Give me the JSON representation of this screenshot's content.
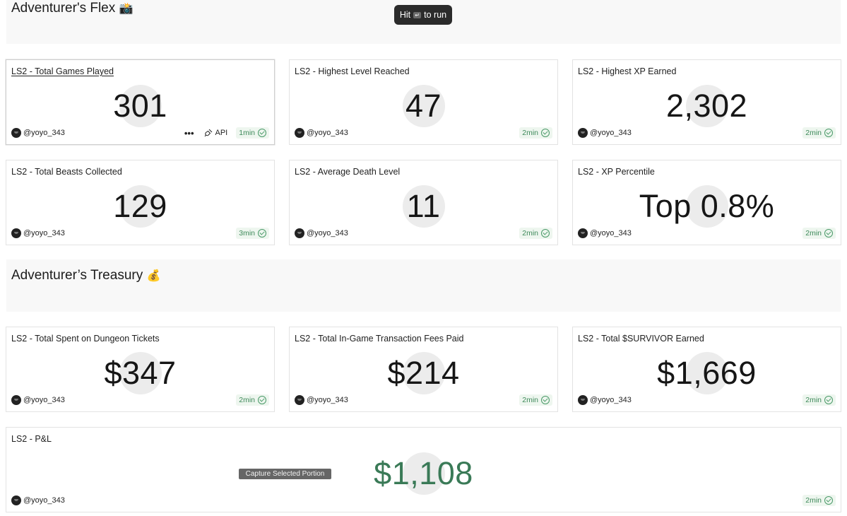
{
  "sections": [
    {
      "title": "Adventurer's Flex",
      "emoji": "📸"
    },
    {
      "title": "Adventurer’s Treasury",
      "emoji": "💰"
    }
  ],
  "tooltip": {
    "prefix": "Hit",
    "key": "↵",
    "suffix": "to run"
  },
  "capture": {
    "label": "Capture Selected Portion"
  },
  "cards": [
    {
      "title": "LS2 - Total Games Played",
      "value": "301",
      "owner": "@yoyo_343",
      "age": "1min",
      "more": "•••",
      "api": "API"
    },
    {
      "title": "LS2 - Highest Level Reached",
      "value": "47",
      "owner": "@yoyo_343",
      "age": "2min"
    },
    {
      "title": "LS2 - Highest XP Earned",
      "value": "2,302",
      "owner": "@yoyo_343",
      "age": "2min"
    },
    {
      "title": "LS2 - Total Beasts Collected",
      "value": "129",
      "owner": "@yoyo_343",
      "age": "3min"
    },
    {
      "title": "LS2 - Average Death Level",
      "value": "11",
      "owner": "@yoyo_343",
      "age": "2min"
    },
    {
      "title": "LS2 - XP Percentile",
      "value": "Top 0.8%",
      "owner": "@yoyo_343",
      "age": "2min"
    },
    {
      "title": "LS2 - Total Spent on Dungeon Tickets",
      "value": "$347",
      "owner": "@yoyo_343",
      "age": "2min"
    },
    {
      "title": "LS2 - Total In-Game Transaction Fees Paid",
      "value": "$214",
      "owner": "@yoyo_343",
      "age": "2min"
    },
    {
      "title": "LS2 - Total $SURVIVOR Earned",
      "value": "$1,669",
      "owner": "@yoyo_343",
      "age": "2min"
    },
    {
      "title": "LS2 - P&L",
      "value": "$1,108",
      "owner": "@yoyo_343",
      "age": "2min",
      "value_color": "#3a7a57"
    }
  ]
}
